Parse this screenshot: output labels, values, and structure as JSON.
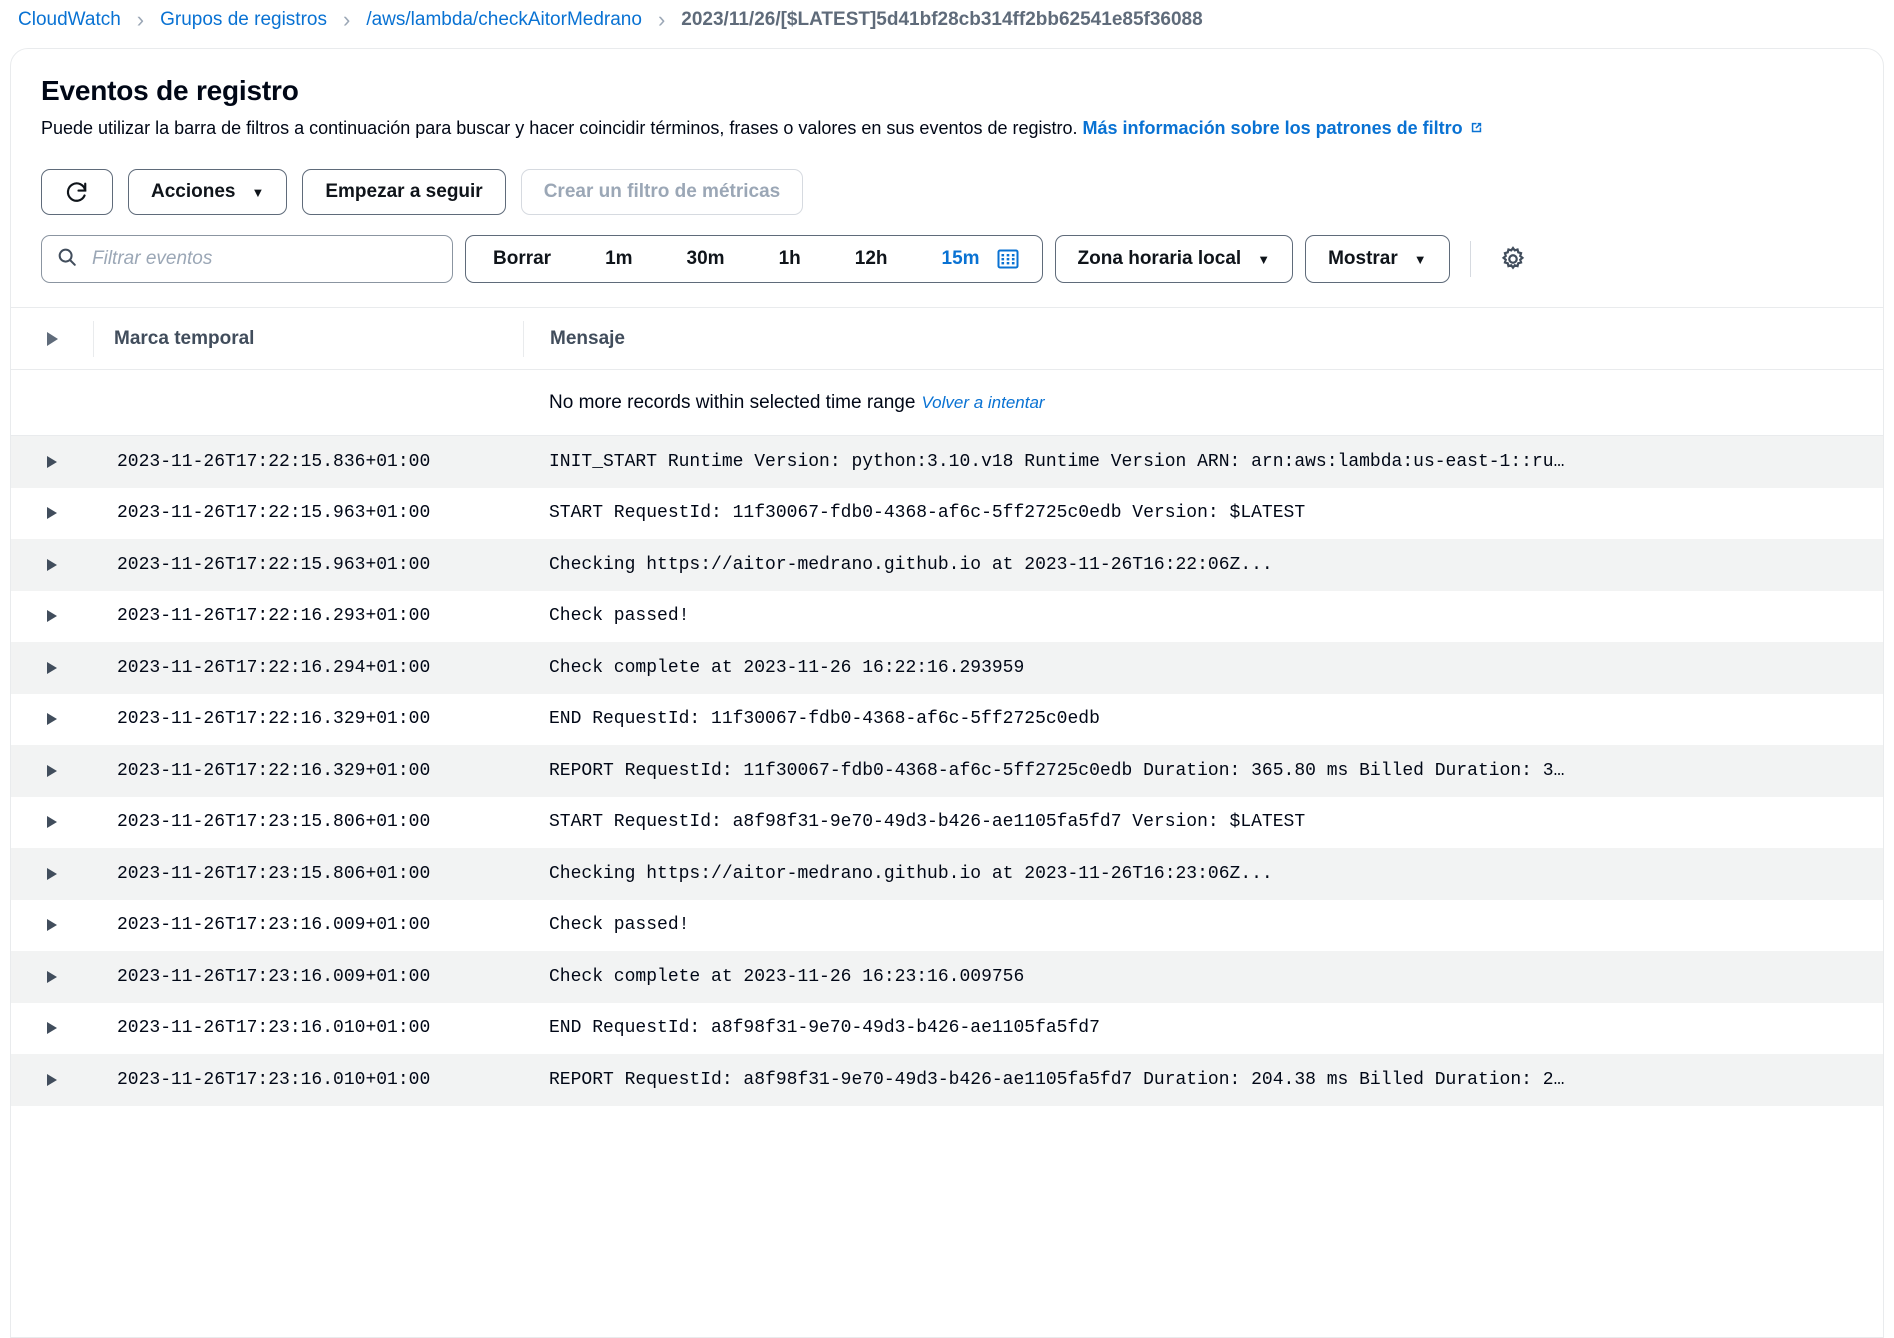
{
  "breadcrumb": {
    "items": [
      {
        "label": "CloudWatch",
        "type": "link"
      },
      {
        "label": "Grupos de registros",
        "type": "link"
      },
      {
        "label": "/aws/lambda/checkAitorMedrano",
        "type": "link"
      },
      {
        "label": "2023/11/26/[$LATEST]5d41bf28cb314ff2bb62541e85f36088",
        "type": "current"
      }
    ],
    "separator": "›"
  },
  "header": {
    "title": "Eventos de registro",
    "description_part1": "Puede utilizar la barra de filtros a continuación para buscar y hacer coincidir términos, frases o valores en sus eventos de registro. ",
    "description_link": "Más información sobre los patrones de filtro",
    "external_icon": "external-link-icon"
  },
  "toolbar": {
    "refresh_icon": "refresh-icon",
    "actions_label": "Acciones",
    "follow_label": "Empezar a seguir",
    "metric_filter_label": "Crear un filtro de métricas",
    "metric_filter_disabled": true,
    "caret": "▼"
  },
  "filterbar": {
    "search_icon": "search-icon",
    "search_placeholder": "Filtrar eventos",
    "search_value": "",
    "ranges": [
      {
        "label": "Borrar",
        "active": false
      },
      {
        "label": "1m",
        "active": false
      },
      {
        "label": "30m",
        "active": false
      },
      {
        "label": "1h",
        "active": false
      },
      {
        "label": "12h",
        "active": false
      },
      {
        "label": "15m",
        "active": true
      }
    ],
    "calendar_icon": "calendar-icon",
    "timezone_label": "Zona horaria local",
    "display_label": "Mostrar",
    "settings_icon": "gear-icon",
    "caret": "▼"
  },
  "table": {
    "columns": {
      "toggle_icon": "expand-all-icon",
      "timestamp": "Marca temporal",
      "message": "Mensaje"
    },
    "notice": {
      "text": "No more records within selected time range",
      "link": "Volver a intentar"
    },
    "rows": [
      {
        "timestamp": "2023-11-26T17:22:15.836+01:00",
        "message": "INIT_START Runtime Version: python:3.10.v18 Runtime Version ARN: arn:aws:lambda:us-east-1::ru…"
      },
      {
        "timestamp": "2023-11-26T17:22:15.963+01:00",
        "message": "START RequestId: 11f30067-fdb0-4368-af6c-5ff2725c0edb Version: $LATEST"
      },
      {
        "timestamp": "2023-11-26T17:22:15.963+01:00",
        "message": "Checking https://aitor-medrano.github.io at 2023-11-26T16:22:06Z..."
      },
      {
        "timestamp": "2023-11-26T17:22:16.293+01:00",
        "message": "Check passed!"
      },
      {
        "timestamp": "2023-11-26T17:22:16.294+01:00",
        "message": "Check complete at 2023-11-26 16:22:16.293959"
      },
      {
        "timestamp": "2023-11-26T17:22:16.329+01:00",
        "message": "END RequestId: 11f30067-fdb0-4368-af6c-5ff2725c0edb"
      },
      {
        "timestamp": "2023-11-26T17:22:16.329+01:00",
        "message": "REPORT RequestId: 11f30067-fdb0-4368-af6c-5ff2725c0edb Duration: 365.80 ms Billed Duration: 3…"
      },
      {
        "timestamp": "2023-11-26T17:23:15.806+01:00",
        "message": "START RequestId: a8f98f31-9e70-49d3-b426-ae1105fa5fd7 Version: $LATEST"
      },
      {
        "timestamp": "2023-11-26T17:23:15.806+01:00",
        "message": "Checking https://aitor-medrano.github.io at 2023-11-26T16:23:06Z..."
      },
      {
        "timestamp": "2023-11-26T17:23:16.009+01:00",
        "message": "Check passed!"
      },
      {
        "timestamp": "2023-11-26T17:23:16.009+01:00",
        "message": "Check complete at 2023-11-26 16:23:16.009756"
      },
      {
        "timestamp": "2023-11-26T17:23:16.010+01:00",
        "message": "END RequestId: a8f98f31-9e70-49d3-b426-ae1105fa5fd7"
      },
      {
        "timestamp": "2023-11-26T17:23:16.010+01:00",
        "message": "REPORT RequestId: a8f98f31-9e70-49d3-b426-ae1105fa5fd7 Duration: 204.38 ms Billed Duration: 2…"
      }
    ]
  },
  "colors": {
    "link": "#0972d3",
    "text": "#000716",
    "muted": "#5f6b7a",
    "row_alt": "#f2f3f3",
    "border": "#e9ebed"
  }
}
